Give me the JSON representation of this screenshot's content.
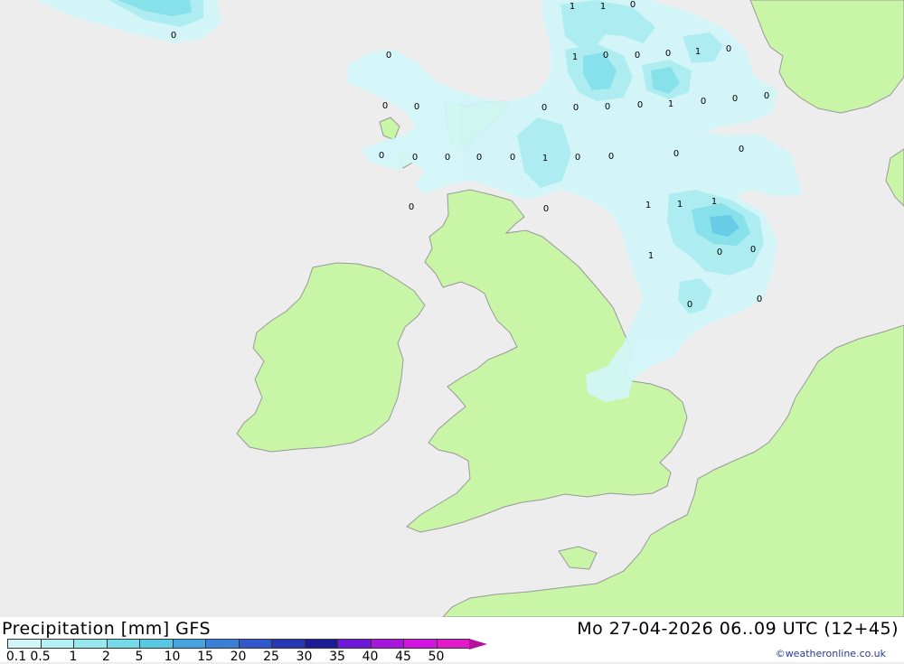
{
  "title_left": "Precipitation [mm] GFS",
  "title_right": "Mo 27-04-2026 06..09 UTC (12+45)",
  "credit": "©weatheronline.co.uk",
  "colors": {
    "sea": "#ededed",
    "land": "#c8f5a6",
    "coast": "#999999",
    "precip_light": "#d2f6f8",
    "precip_mid": "#a8eef2",
    "precip_heavy": "#7fe0ea",
    "precip_max": "#5ccbe6"
  },
  "legend": {
    "ticks": [
      "0.1",
      "0.5",
      "1",
      "2",
      "5",
      "10",
      "15",
      "20",
      "25",
      "30",
      "35",
      "40",
      "45",
      "50"
    ],
    "colors": [
      "#d2f6f8",
      "#b4f0f4",
      "#96e8ee",
      "#76dbe8",
      "#58c8e4",
      "#45a4e0",
      "#3a80d8",
      "#3058cc",
      "#2838b4",
      "#1c1c96",
      "#7018d8",
      "#a816dc",
      "#d414e0",
      "#e21aca",
      "#b0109a"
    ]
  },
  "values": [
    {
      "text": "1"
    },
    {
      "text": "1"
    },
    {
      "text": "0"
    },
    {
      "text": "0"
    },
    {
      "text": "0"
    },
    {
      "text": "1"
    },
    {
      "text": "0"
    },
    {
      "text": "0"
    },
    {
      "text": "0"
    },
    {
      "text": "1"
    },
    {
      "text": "0"
    },
    {
      "text": "0"
    },
    {
      "text": "0"
    },
    {
      "text": "0"
    },
    {
      "text": "0"
    },
    {
      "text": "0"
    },
    {
      "text": "1"
    },
    {
      "text": "0"
    },
    {
      "text": "0"
    },
    {
      "text": "0"
    },
    {
      "text": "0"
    },
    {
      "text": "0"
    },
    {
      "text": "0"
    },
    {
      "text": "0"
    },
    {
      "text": "0"
    },
    {
      "text": "1"
    },
    {
      "text": "0"
    },
    {
      "text": "0"
    },
    {
      "text": "0"
    },
    {
      "text": "0"
    },
    {
      "text": "0"
    },
    {
      "text": "1"
    },
    {
      "text": "0"
    },
    {
      "text": "1"
    },
    {
      "text": "0"
    },
    {
      "text": "1"
    },
    {
      "text": "0"
    },
    {
      "text": "1"
    },
    {
      "text": "0"
    },
    {
      "text": "0"
    },
    {
      "text": "0"
    }
  ]
}
